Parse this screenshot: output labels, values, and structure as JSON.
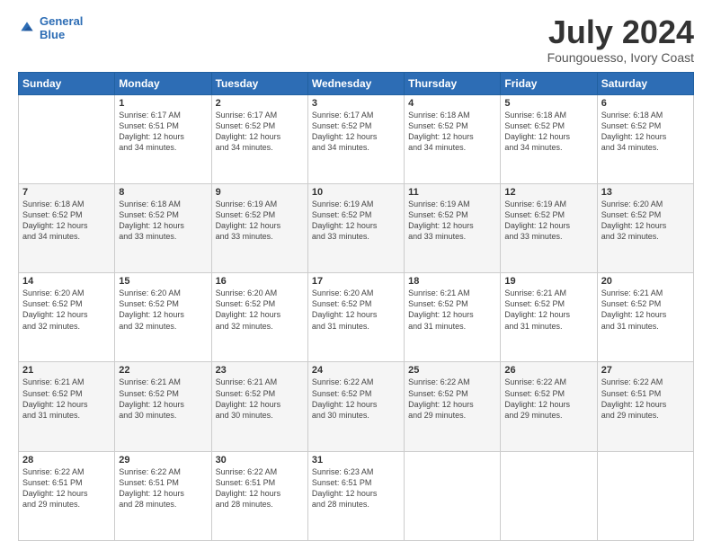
{
  "logo": {
    "line1": "General",
    "line2": "Blue"
  },
  "title": "July 2024",
  "subtitle": "Foungouesso, Ivory Coast",
  "header_days": [
    "Sunday",
    "Monday",
    "Tuesday",
    "Wednesday",
    "Thursday",
    "Friday",
    "Saturday"
  ],
  "weeks": [
    [
      {
        "day": "",
        "info": ""
      },
      {
        "day": "1",
        "info": "Sunrise: 6:17 AM\nSunset: 6:51 PM\nDaylight: 12 hours\nand 34 minutes."
      },
      {
        "day": "2",
        "info": "Sunrise: 6:17 AM\nSunset: 6:52 PM\nDaylight: 12 hours\nand 34 minutes."
      },
      {
        "day": "3",
        "info": "Sunrise: 6:17 AM\nSunset: 6:52 PM\nDaylight: 12 hours\nand 34 minutes."
      },
      {
        "day": "4",
        "info": "Sunrise: 6:18 AM\nSunset: 6:52 PM\nDaylight: 12 hours\nand 34 minutes."
      },
      {
        "day": "5",
        "info": "Sunrise: 6:18 AM\nSunset: 6:52 PM\nDaylight: 12 hours\nand 34 minutes."
      },
      {
        "day": "6",
        "info": "Sunrise: 6:18 AM\nSunset: 6:52 PM\nDaylight: 12 hours\nand 34 minutes."
      }
    ],
    [
      {
        "day": "7",
        "info": "Sunrise: 6:18 AM\nSunset: 6:52 PM\nDaylight: 12 hours\nand 34 minutes."
      },
      {
        "day": "8",
        "info": "Sunrise: 6:18 AM\nSunset: 6:52 PM\nDaylight: 12 hours\nand 33 minutes."
      },
      {
        "day": "9",
        "info": "Sunrise: 6:19 AM\nSunset: 6:52 PM\nDaylight: 12 hours\nand 33 minutes."
      },
      {
        "day": "10",
        "info": "Sunrise: 6:19 AM\nSunset: 6:52 PM\nDaylight: 12 hours\nand 33 minutes."
      },
      {
        "day": "11",
        "info": "Sunrise: 6:19 AM\nSunset: 6:52 PM\nDaylight: 12 hours\nand 33 minutes."
      },
      {
        "day": "12",
        "info": "Sunrise: 6:19 AM\nSunset: 6:52 PM\nDaylight: 12 hours\nand 33 minutes."
      },
      {
        "day": "13",
        "info": "Sunrise: 6:20 AM\nSunset: 6:52 PM\nDaylight: 12 hours\nand 32 minutes."
      }
    ],
    [
      {
        "day": "14",
        "info": "Sunrise: 6:20 AM\nSunset: 6:52 PM\nDaylight: 12 hours\nand 32 minutes."
      },
      {
        "day": "15",
        "info": "Sunrise: 6:20 AM\nSunset: 6:52 PM\nDaylight: 12 hours\nand 32 minutes."
      },
      {
        "day": "16",
        "info": "Sunrise: 6:20 AM\nSunset: 6:52 PM\nDaylight: 12 hours\nand 32 minutes."
      },
      {
        "day": "17",
        "info": "Sunrise: 6:20 AM\nSunset: 6:52 PM\nDaylight: 12 hours\nand 31 minutes."
      },
      {
        "day": "18",
        "info": "Sunrise: 6:21 AM\nSunset: 6:52 PM\nDaylight: 12 hours\nand 31 minutes."
      },
      {
        "day": "19",
        "info": "Sunrise: 6:21 AM\nSunset: 6:52 PM\nDaylight: 12 hours\nand 31 minutes."
      },
      {
        "day": "20",
        "info": "Sunrise: 6:21 AM\nSunset: 6:52 PM\nDaylight: 12 hours\nand 31 minutes."
      }
    ],
    [
      {
        "day": "21",
        "info": "Sunrise: 6:21 AM\nSunset: 6:52 PM\nDaylight: 12 hours\nand 31 minutes."
      },
      {
        "day": "22",
        "info": "Sunrise: 6:21 AM\nSunset: 6:52 PM\nDaylight: 12 hours\nand 30 minutes."
      },
      {
        "day": "23",
        "info": "Sunrise: 6:21 AM\nSunset: 6:52 PM\nDaylight: 12 hours\nand 30 minutes."
      },
      {
        "day": "24",
        "info": "Sunrise: 6:22 AM\nSunset: 6:52 PM\nDaylight: 12 hours\nand 30 minutes."
      },
      {
        "day": "25",
        "info": "Sunrise: 6:22 AM\nSunset: 6:52 PM\nDaylight: 12 hours\nand 29 minutes."
      },
      {
        "day": "26",
        "info": "Sunrise: 6:22 AM\nSunset: 6:52 PM\nDaylight: 12 hours\nand 29 minutes."
      },
      {
        "day": "27",
        "info": "Sunrise: 6:22 AM\nSunset: 6:51 PM\nDaylight: 12 hours\nand 29 minutes."
      }
    ],
    [
      {
        "day": "28",
        "info": "Sunrise: 6:22 AM\nSunset: 6:51 PM\nDaylight: 12 hours\nand 29 minutes."
      },
      {
        "day": "29",
        "info": "Sunrise: 6:22 AM\nSunset: 6:51 PM\nDaylight: 12 hours\nand 28 minutes."
      },
      {
        "day": "30",
        "info": "Sunrise: 6:22 AM\nSunset: 6:51 PM\nDaylight: 12 hours\nand 28 minutes."
      },
      {
        "day": "31",
        "info": "Sunrise: 6:23 AM\nSunset: 6:51 PM\nDaylight: 12 hours\nand 28 minutes."
      },
      {
        "day": "",
        "info": ""
      },
      {
        "day": "",
        "info": ""
      },
      {
        "day": "",
        "info": ""
      }
    ]
  ]
}
